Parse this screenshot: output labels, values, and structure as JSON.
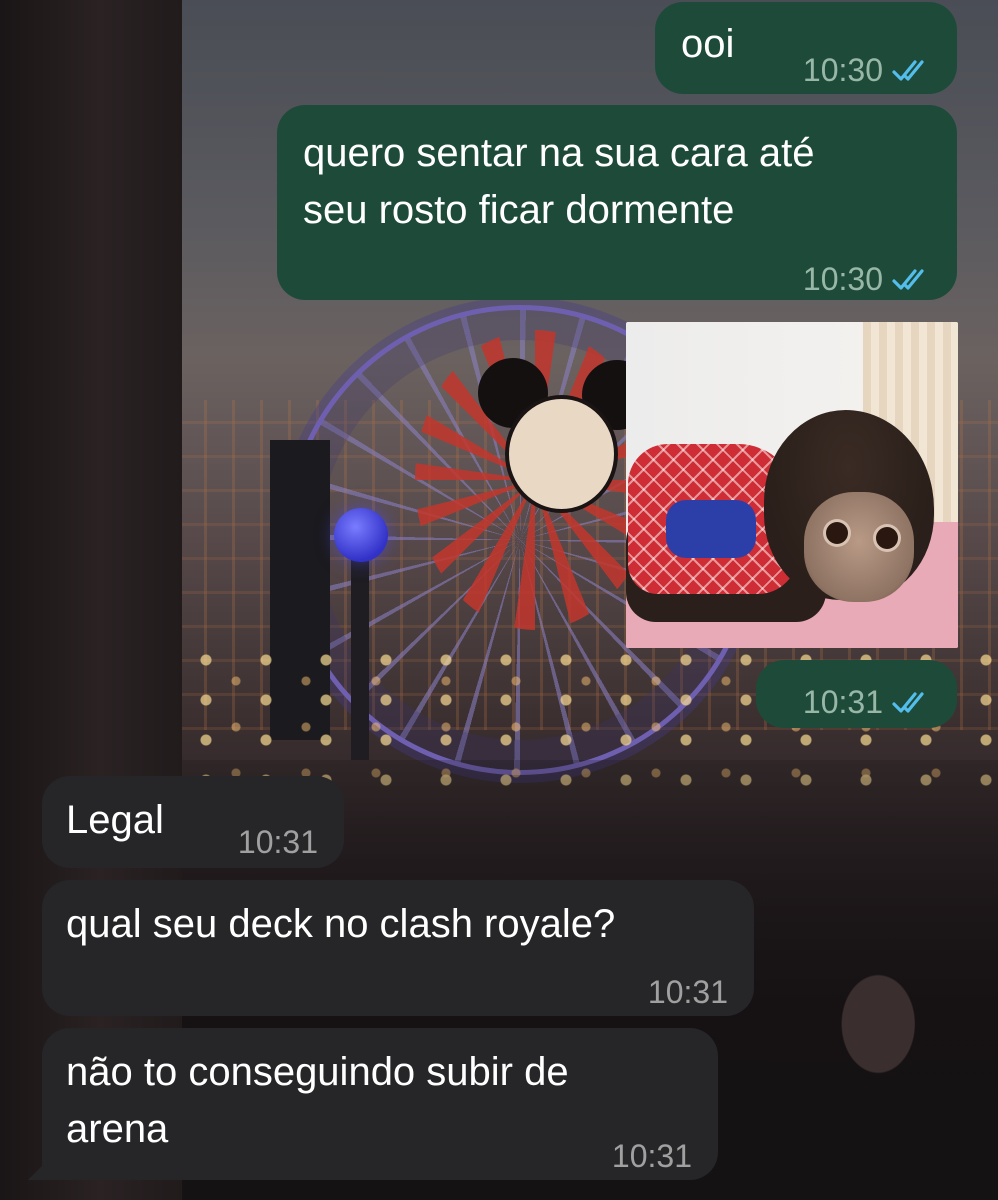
{
  "messages": [
    {
      "direction": "outgoing",
      "text": "ooi",
      "time": "10:30",
      "status": "read"
    },
    {
      "direction": "outgoing",
      "text": "quero sentar na sua cara até\nseu rosto ficar dormente",
      "time": "10:30",
      "status": "read"
    },
    {
      "direction": "outgoing",
      "type": "image",
      "image_subject": "capuchin-monkey-in-red-spider-shirt-photo",
      "time": "10:31",
      "status": "read"
    },
    {
      "direction": "incoming",
      "text": "Legal",
      "time": "10:31"
    },
    {
      "direction": "incoming",
      "text": "qual seu deck no clash royale?",
      "time": "10:31"
    },
    {
      "direction": "incoming",
      "text": "não to conseguindo subir de\narena",
      "time": "10:31"
    }
  ],
  "colors": {
    "outgoing_bubble": "#1e4b39",
    "incoming_bubble": "#262628",
    "read_ticks": "#53bdeb",
    "text": "#ffffff"
  },
  "icons": {
    "read_receipt": "double-check-icon"
  },
  "wallpaper": "amusement-park-night-wallpaper"
}
